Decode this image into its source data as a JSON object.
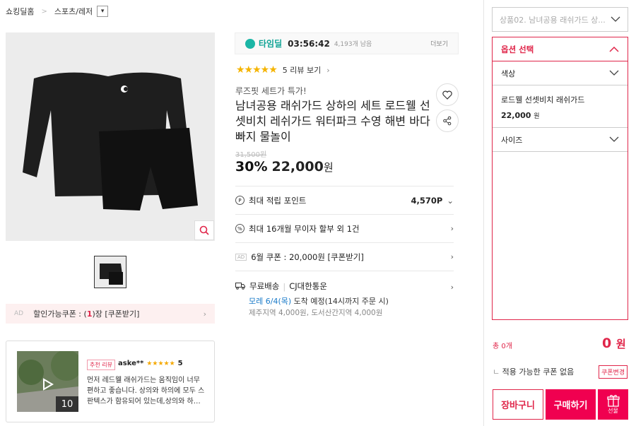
{
  "breadcrumb": {
    "home": "쇼킹딜홈",
    "category": "스포츠/레저"
  },
  "gallery": {
    "thumb_count": 1
  },
  "coupon_bar": {
    "ad": "AD",
    "pre": "할인가능쿠폰 : (",
    "count": "1",
    "post": ")장 [쿠폰받기]"
  },
  "review_card": {
    "count": "10",
    "tag": "추천 리뷰",
    "user": "aske**",
    "stars": "★★★★★",
    "score": "5",
    "text": "먼저 레드웰 래쉬가드는 움직임이 너무 편하고 좋습니다. 상의와 하의에 모두 스판텍스가 함유되어 있는데,상의와 하…"
  },
  "timedeal": {
    "label": "타임딜",
    "time": "03:56:42",
    "remaining": "4,193개 남음",
    "more": "더보기"
  },
  "rating": {
    "stars": "★★★★★",
    "reviews": "5 리뷰 보기"
  },
  "product": {
    "promo": "루즈핏 세트가 특가!",
    "title": "남녀공용 래쉬가드 상하의 세트 로드웰 선셋비치 레쉬가드 워터파크 수영 해변 바다 빠지 물놀이",
    "original_price": "31,500원",
    "discount": "30%",
    "price": "22,000",
    "price_unit": "원"
  },
  "benefits": {
    "points_label": "최대 적립 포인트",
    "points_value": "4,570P",
    "installment": "최대 16개월 무이자 할부 외 1건",
    "coupon_ad": "AD",
    "coupon": "6월 쿠폰 : 20,000원 [쿠폰받기]",
    "shipping": "무료배송",
    "courier": "CJ대한통운",
    "arrival_date": "모레 6/4(목)",
    "arrival_rest": " 도착 예정(14시까지 주문 시)",
    "extra_fee": "제주지역 4,000원, 도서산간지역 4,000원"
  },
  "panel": {
    "product_select": "상품02. 남녀공용 래쉬가드 상...",
    "option_header": "옵션 선택",
    "color_label": "색상",
    "selected_item": "로드웰 선셋비치 래쉬가드",
    "selected_price": "22,000",
    "selected_unit": "원",
    "size_label": "사이즈",
    "total_label": "총 0개",
    "total_value": "0",
    "total_unit": "원",
    "coupon_status": "적용 가능한 쿠폰 없음",
    "coupon_change": "쿠폰변경",
    "cart": "장바구니",
    "buy": "구매하기",
    "gift": "선물"
  },
  "colors": {
    "accent": "#e0264a",
    "buy": "#f00050",
    "timedeal": "#0fa395"
  }
}
